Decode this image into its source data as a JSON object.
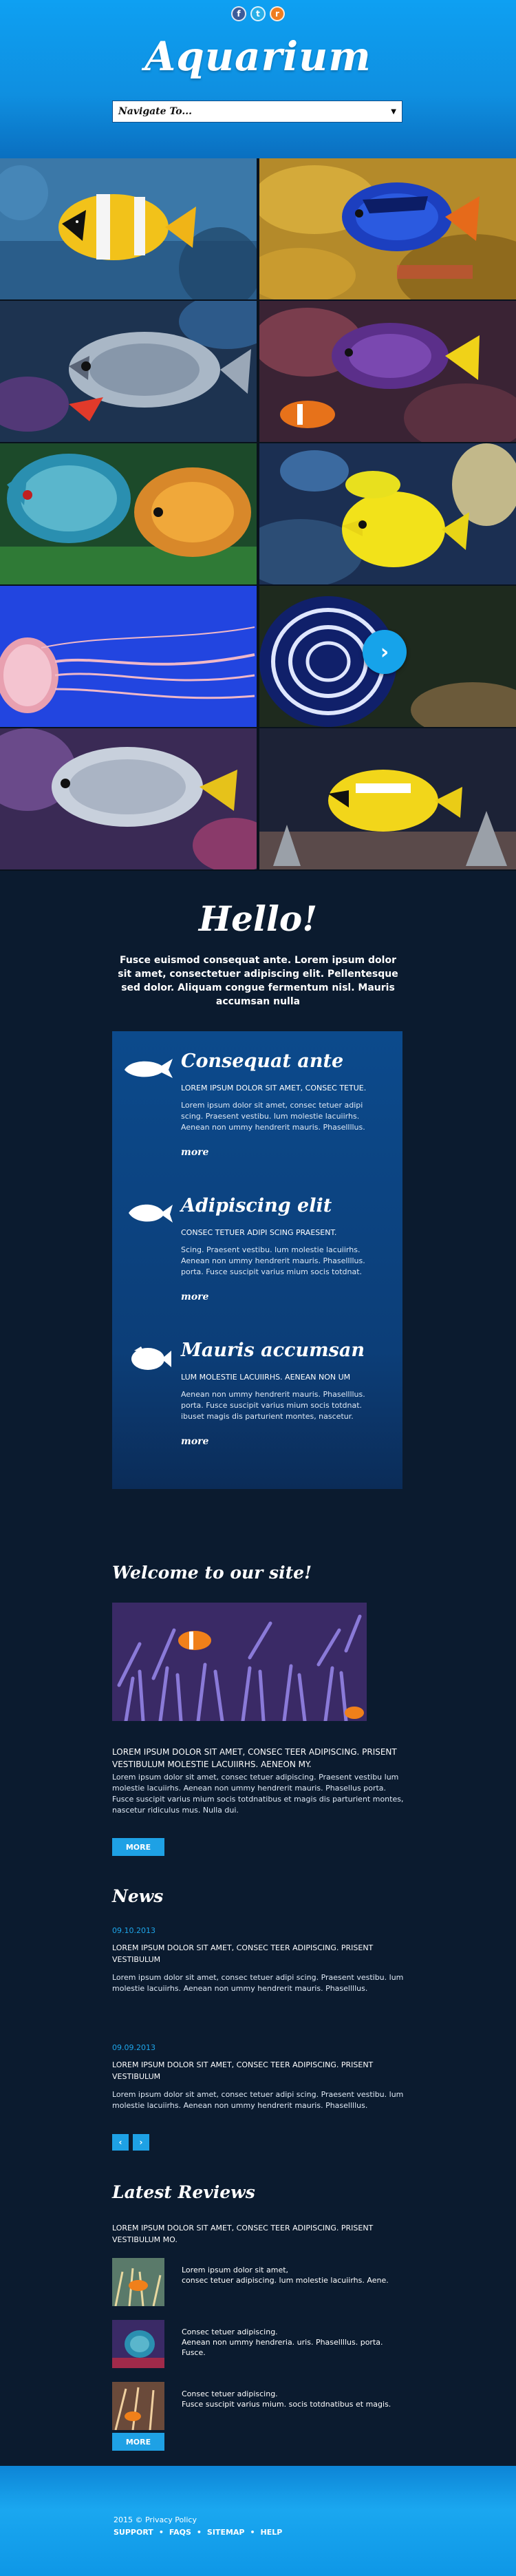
{
  "header": {
    "logo": "Aquarium",
    "social": [
      {
        "label": "f",
        "icon": "facebook-icon",
        "color": "#3b5b9a"
      },
      {
        "label": "t",
        "icon": "twitter-icon",
        "color": "#27aee8"
      },
      {
        "label": "r",
        "icon": "rss-icon",
        "color": "#ef7d20"
      }
    ],
    "nav_select": "Navigate To..."
  },
  "gallery": {
    "next_label": "›"
  },
  "hello": {
    "title": "Hello!",
    "text": "Fusce euismod consequat ante. Lorem ipsum dolor sit amet, consectetuer adipiscing elit. Pellentesque sed dolor. Aliquam congue fermentum nisl. Mauris accumsan nulla"
  },
  "features": [
    {
      "title": "Consequat ante",
      "sub": "LOREM IPSUM DOLOR SIT AMET, CONSEC TETUE.",
      "desc": "Lorem ipsum dolor sit amet, consec tetuer adipi scing. Praesent vestibu. lum molestie lacuiirhs. Aenean non ummy hendrerit mauris. Phasellllus.",
      "more": "more"
    },
    {
      "title": "Adipiscing elit",
      "sub": "CONSEC TETUER ADIPI SCING PRAESENT.",
      "desc": "Scing. Praesent vestibu. lum molestie lacuiirhs. Aenean non ummy hendrerit mauris. Phasellllus. porta. Fusce suscipit varius mium socis totdnat.",
      "more": "more"
    },
    {
      "title": "Mauris accumsan",
      "sub": "LUM MOLESTIE LACUIIRHS. AENEAN NON UM",
      "desc": "Aenean non ummy hendrerit mauris. Phasellllus. porta. Fusce suscipit varius mium socis totdnat. ibuset magis dis parturient montes, nascetur.",
      "more": "more"
    }
  ],
  "welcome": {
    "title": "Welcome to our site!",
    "caps": "LOREM IPSUM DOLOR SIT AMET, CONSEC TEER ADIPISCING. PRISENT VESTIBULUM MOLESTIE LACUIIRHS. AENEON MY.",
    "body": "Lorem ipsum dolor sit amet, consec tetuer adipiscing. Praesent vestibu lum molestie lacuiirhs. Aenean non ummy hendrerit mauris. Phasellus porta. Fusce suscipit varius mium socis totdnatibus et magis dis parturient montes, nascetur ridiculus mus. Nulla dui.",
    "button": "MORE"
  },
  "news": {
    "title": "News",
    "items": [
      {
        "date": "09.10.2013",
        "caps": "LOREM IPSUM DOLOR SIT AMET, CONSEC TEER ADIPISCING. PRISENT VESTIBULUM",
        "body": "Lorem ipsum dolor sit amet, consec tetuer adipi scing. Praesent vestibu. lum molestie lacuiirhs. Aenean non ummy hendrerit mauris. Phasellllus."
      },
      {
        "date": "09.09.2013",
        "caps": "LOREM IPSUM DOLOR SIT AMET, CONSEC TEER ADIPISCING. PRISENT VESTIBULUM",
        "body": "Lorem ipsum dolor sit amet, consec tetuer adipi scing. Praesent vestibu. lum molestie lacuiirhs. Aenean non ummy hendrerit mauris. Phasellllus."
      }
    ],
    "prev": "‹",
    "next": "›"
  },
  "reviews": {
    "title": "Latest Reviews",
    "caps": "LOREM IPSUM DOLOR SIT AMET, CONSEC TEER ADIPISCING. PRISENT VESTIBULUM MO.",
    "items": [
      {
        "text": "Lorem ipsum dolor sit amet,\nconsec tetuer adipiscing. lum molestie lacuiirhs. Aene."
      },
      {
        "text": "Consec tetuer adipiscing.\nAenean non ummy hendreria. uris. Phasellllus. porta. Fusce."
      },
      {
        "text": "Consec tetuer adipiscing.\nFusce suscipit varius mium. socis totdnatibus et magis."
      }
    ],
    "button": "MORE"
  },
  "footer": {
    "copyright": "2015 © Privacy Policy",
    "links": [
      "SUPPORT",
      "FAQS",
      "SITEMAP",
      "HELP"
    ]
  }
}
